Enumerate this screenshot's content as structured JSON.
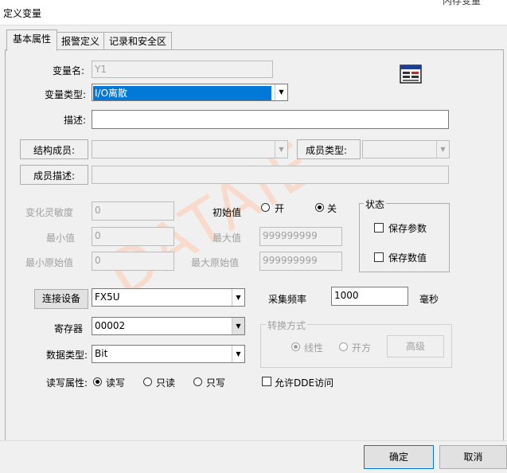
{
  "window": {
    "title": "定义变量",
    "behind_title": "内存变量"
  },
  "tabs": [
    "基本属性",
    "报警定义",
    "记录和安全区"
  ],
  "form": {
    "var_name_label": "变量名:",
    "var_name_value": "Y1",
    "var_type_label": "变量类型:",
    "var_type_value": "I/O离散",
    "desc_label": "描述:",
    "desc_value": "",
    "struct_member_label": "结构成员:",
    "member_type_label": "成员类型:",
    "member_desc_label": "成员描述:",
    "sensitivity_label": "变化灵敏度",
    "sensitivity_value": "0",
    "min_label": "最小值",
    "min_value": "0",
    "min_raw_label": "最小原始值",
    "min_raw_value": "0",
    "initial_label": "初始值",
    "initial_on": "开",
    "initial_off": "关",
    "initial_selected": "off",
    "max_label": "最大值",
    "max_value": "999999999",
    "max_raw_label": "最大原始值",
    "max_raw_value": "999999999",
    "status_group_label": "状态",
    "save_params_label": "保存参数",
    "save_values_label": "保存数值",
    "connect_device_button": "连接设备",
    "device_value": "FX5U",
    "sample_freq_label": "采集频率",
    "sample_freq_value": "1000",
    "sample_freq_unit": "毫秒",
    "register_label": "寄存器",
    "register_value": "00002",
    "conversion_group_label": "转换方式",
    "conv_linear": "线性",
    "conv_sqrt": "开方",
    "advanced_button": "高级",
    "data_type_label": "数据类型:",
    "data_type_value": "Bit",
    "rw_label": "读写属性:",
    "rw_readwrite": "读写",
    "rw_readonly": "只读",
    "rw_writeonly": "只写",
    "rw_selected": "readwrite",
    "dde_label": "允许DDE访问"
  },
  "footer": {
    "ok": "确定",
    "cancel": "取消"
  },
  "watermark": "DATAIE",
  "colors": {
    "selection": "#0078d7",
    "background": "#f0f0f0"
  }
}
